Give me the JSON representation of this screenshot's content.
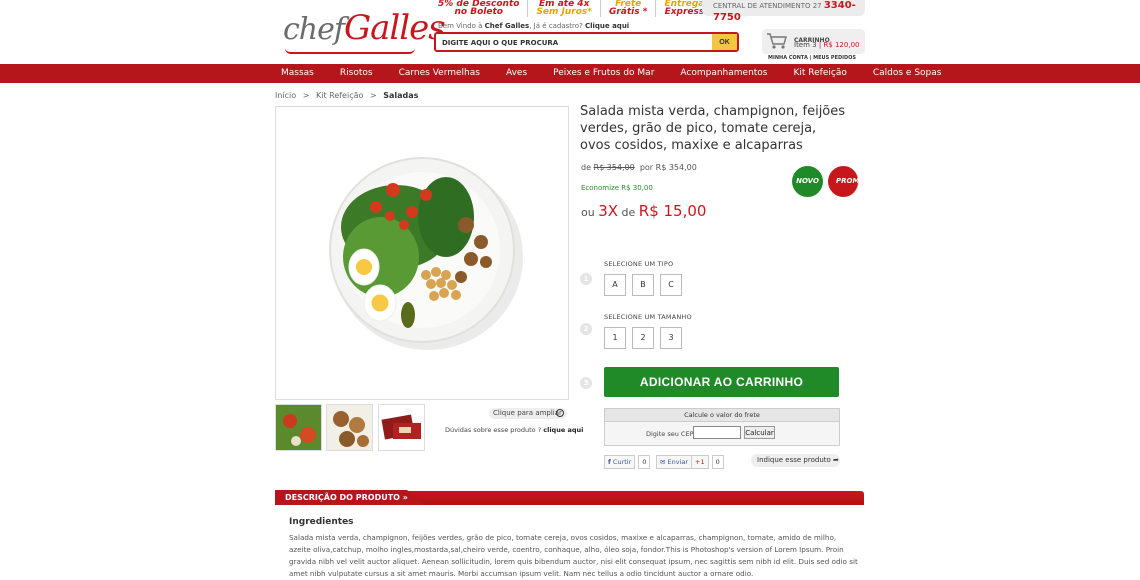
{
  "header": {
    "logo_chef": "chef",
    "logo_galles": "Galles",
    "promos": [
      {
        "l1": "5% de Desconto",
        "l2": "no Boleto"
      },
      {
        "l1": "Em até 4x",
        "l2": "Sem Juros*"
      },
      {
        "l1": "Frete",
        "l2": "Grátis *"
      },
      {
        "l1": "Entrega",
        "l2": "Express"
      }
    ],
    "central_label": "CENTRAL DE ATENDIMENTO 27",
    "central_phone": "3340-7750",
    "welcome": "Bem Vindo à ",
    "welcome_brand": "Chef Galles",
    "welcome_rest": ", Já é cadastro? ",
    "welcome_link": "Clique aqui",
    "search_placeholder": "DIGITE AQUI O QUE PROCURA",
    "search_button": "OK",
    "cart_title": "CARRINHO",
    "cart_items": "Item 3",
    "cart_total": "R$ 120,00",
    "account_links": "MINHA CONTA  |  MEUS PEDIDOS"
  },
  "nav": [
    "Massas",
    "Risotos",
    "Carnes Vermelhas",
    "Aves",
    "Peixes e Frutos do Mar",
    "Acompanhamentos",
    "Kit Refeição",
    "Caldos e Sopas"
  ],
  "breadcrumb": {
    "home": "Início",
    "sep": ">",
    "category": "Kit Refeição",
    "current": "Saladas"
  },
  "gallery": {
    "zoom_label": "Clique para ampliar",
    "doubt_text": "Dúvidas sobre esse produto ? ",
    "doubt_link": "clique aqui"
  },
  "product": {
    "title": "Salada mista verda, champignon, feijões verdes, grão de pico, tomate cereja, ovos cosidos, maxixe e alcaparras",
    "price_from_label": "de",
    "price_old": "R$ 354,00",
    "price_by_label": "por",
    "price_new": "R$ 354,00",
    "economize": "Economize R$ 30,00",
    "inst_prefix": "ou",
    "inst_times": "3X",
    "inst_de": "de",
    "inst_value": "R$ 15,00",
    "badge_new": "NOVO",
    "badge_promo": "PROMO"
  },
  "options": {
    "step1": "1",
    "step2": "2",
    "step3": "3",
    "type_label": "SELECIONE UM TIPO",
    "types": [
      "A",
      "B",
      "C"
    ],
    "size_label": "SELECIONE UM TAMANHO",
    "sizes": [
      "1",
      "2",
      "3"
    ],
    "add_to_cart": "ADICIONAR  AO CARRINHO"
  },
  "freight": {
    "title": "Calcule o valor do frete",
    "cep_label": "Digite seu CEP:",
    "button": "Calcular"
  },
  "social": {
    "fb_label": "Curtir",
    "fb_count": "0",
    "tw_label": "Enviar",
    "tw_count": "0",
    "gp_label": "+1",
    "gp_count": "0",
    "indique": "Indique esse produto"
  },
  "description": {
    "tab": "DESCRIÇÃO DO PRODUTO",
    "heading": "Ingredientes",
    "text": "Salada mista verda, champignon, feijões verdes, grão de pico, tomate cereja, ovos cosidos, maxixe e alcaparras, champignon, tomate, amido de milho, azeite oliva,catchup, molho ingles,mostarda,sal,cheiro verde, coentro, conhaque, alho, óleo soja, fondor.This is Photoshop's version  of Lorem Ipsum. Proin gravida nibh vel velit auctor aliquet. Aenean sollicitudin, lorem quis bibendum auctor, nisi elit consequat ipsum, nec sagittis sem nibh id elit. Duis sed odio sit amet nibh vulputate cursus a sit amet mauris. Morbi accumsan ipsum velit. Nam nec tellus a odio tincidunt auctor a ornare odio."
  },
  "colors": {
    "brand_red": "#b5161c",
    "green": "#1f8a27",
    "accent_yellow": "#f4c542"
  }
}
